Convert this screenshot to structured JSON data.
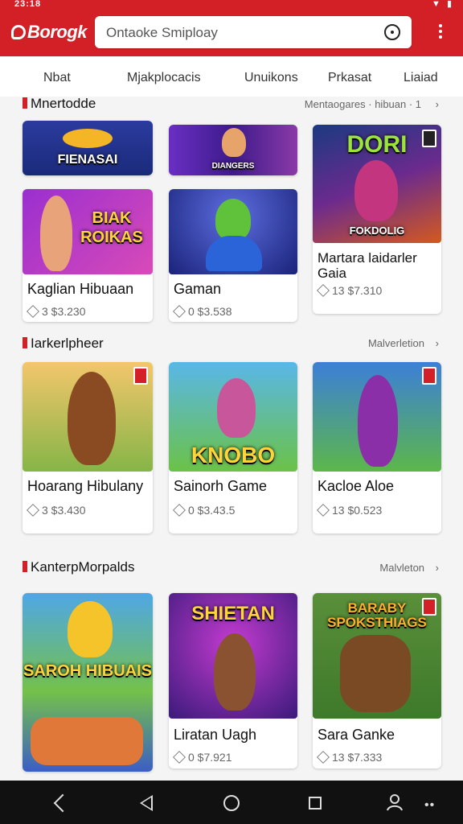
{
  "status": {
    "time": "23:18",
    "battery": "▮"
  },
  "app": {
    "logo": "Borogk",
    "search_placeholder": "Ontaoke Smiploay"
  },
  "tabs": [
    "Nbat",
    "Mjakplocacis",
    "Unuikons",
    "Prkasat",
    "Liaiad"
  ],
  "sections": [
    {
      "title": "Mnertodde",
      "more": "Mentaogares · hibuan · 1",
      "cards": [
        {
          "banner": "FIENASAI",
          "title": "",
          "meta": ""
        },
        {
          "banner": "DIANGERS",
          "title": "",
          "meta": ""
        },
        {
          "banner": "DORI",
          "sub": "FOKDOLIG",
          "title": "Martara laidarler Gaia",
          "meta": "13 $7.310"
        },
        {
          "banner": "BIAK ROIKAS",
          "title": "Kaglian Hibuaan",
          "meta": "3 $3.230"
        },
        {
          "banner": "",
          "title": "Gaman",
          "meta": "0 $3.538"
        }
      ]
    },
    {
      "title": "Iarkerlpheer",
      "more": "Malverletion",
      "cards": [
        {
          "banner": "",
          "title": "Hoarang Hibulany",
          "meta": "3 $3.430"
        },
        {
          "banner": "KNOBO",
          "title": "Sainorh Game",
          "meta": "0 $3.43.5"
        },
        {
          "banner": "",
          "title": "Kacloe Aloe",
          "meta": "13 $0.523"
        }
      ]
    },
    {
      "title": "KanterpMorpalds",
      "more": "Malvleton",
      "cards": [
        {
          "banner": "SAROH HIBUAIS",
          "title": "",
          "meta": ""
        },
        {
          "banner": "SHIETAN",
          "title": "Liratan Uagh",
          "meta": "0 $7.921"
        },
        {
          "banner": "BARABY SPOKSTHIAGS",
          "title": "Sara Ganke",
          "meta": "13 $7.333"
        }
      ]
    }
  ]
}
